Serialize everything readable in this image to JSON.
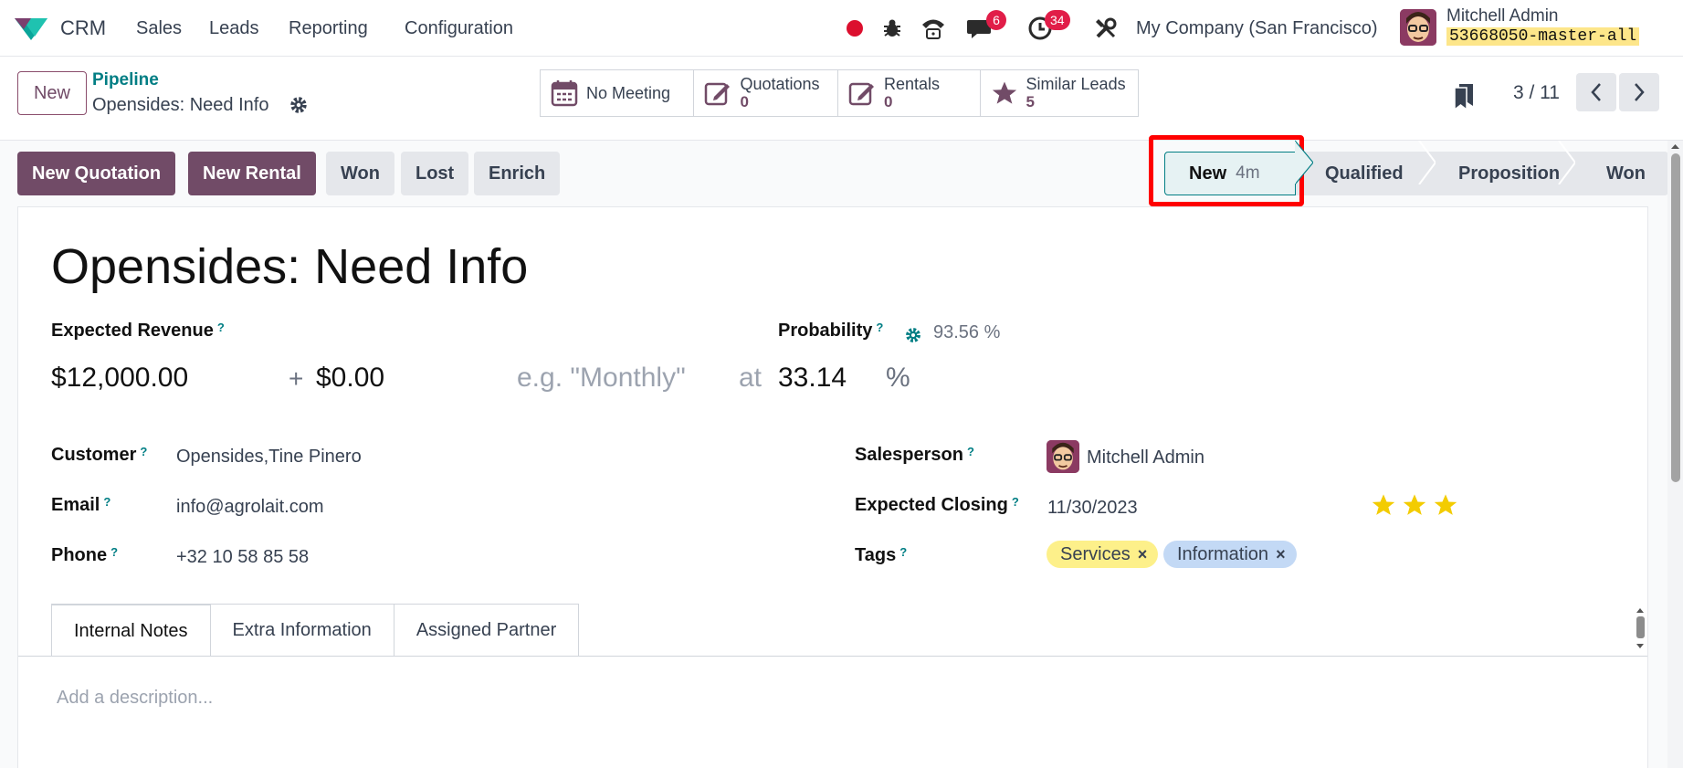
{
  "navbar": {
    "app_name": "CRM",
    "menu": [
      "Sales",
      "Leads",
      "Reporting",
      "Configuration"
    ],
    "messages_count": "6",
    "activities_count": "34",
    "company": "My Company (San Francisco)",
    "user_name": "Mitchell Admin",
    "database": "53668050-master-all"
  },
  "control_panel": {
    "new_label": "New",
    "breadcrumb_parent": "Pipeline",
    "breadcrumb_current": "Opensides: Need Info",
    "smart_buttons": [
      {
        "label": "No Meeting",
        "value": "",
        "icon": "calendar-icon"
      },
      {
        "label": "Quotations",
        "value": "0",
        "icon": "edit-icon"
      },
      {
        "label": "Rentals",
        "value": "0",
        "icon": "edit-icon"
      },
      {
        "label": "Similar Leads",
        "value": "5",
        "icon": "star-icon"
      }
    ],
    "pager": "3 / 11"
  },
  "status_bar": {
    "buttons": [
      "New Quotation",
      "New Rental",
      "Won",
      "Lost",
      "Enrich"
    ],
    "stages": [
      {
        "label": "New",
        "duration": "4m",
        "active": true
      },
      {
        "label": "Qualified",
        "duration": "",
        "active": false
      },
      {
        "label": "Proposition",
        "duration": "",
        "active": false
      },
      {
        "label": "Won",
        "duration": "",
        "active": false
      }
    ]
  },
  "form": {
    "title": "Opensides: Need Info",
    "expected_revenue_label": "Expected Revenue",
    "expected_revenue": "$12,000.00",
    "plus": "+",
    "recurring_revenue": "$0.00",
    "recurring_plan_placeholder": "e.g. \"Monthly\"",
    "at": "at",
    "probability_label": "Probability",
    "probability_auto": "93.56 %",
    "probability": "33.14",
    "percent": "%",
    "help": "?",
    "customer_label": "Customer",
    "customer": "Opensides,Tine Pinero",
    "email_label": "Email",
    "email": "info@agrolait.com",
    "phone_label": "Phone",
    "phone": "+32 10 58 85 58",
    "salesperson_label": "Salesperson",
    "salesperson": "Mitchell Admin",
    "expected_closing_label": "Expected Closing",
    "expected_closing": "11/30/2023",
    "priority_stars": 3,
    "tags_label": "Tags",
    "tags": [
      {
        "label": "Services",
        "color": "#fdf08a"
      },
      {
        "label": "Information",
        "color": "#c3d9f5"
      }
    ],
    "remove_symbol": "×"
  },
  "tabs": [
    "Internal Notes",
    "Extra Information",
    "Assigned Partner"
  ],
  "description_placeholder": "Add a description...",
  "colors": {
    "brand": "#714b67",
    "link": "#017e84",
    "badge": "#e11d48",
    "highlight_box": "#ff0000"
  }
}
